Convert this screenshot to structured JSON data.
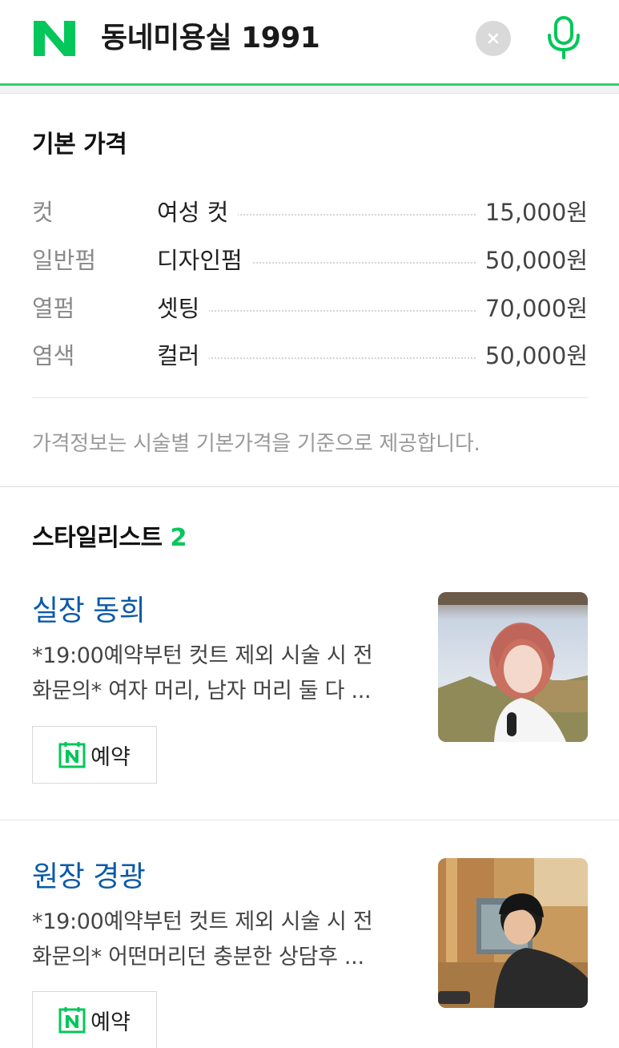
{
  "header": {
    "logo_letter": "N",
    "query": "동네미용실 1991",
    "clear_icon": "close-icon",
    "mic_icon": "microphone-icon",
    "accent_color": "#03c75a"
  },
  "prices": {
    "title": "기본 가격",
    "items": [
      {
        "category": "컷",
        "name": "여성 컷",
        "price": "15,000원"
      },
      {
        "category": "일반펌",
        "name": "디자인펌",
        "price": "50,000원"
      },
      {
        "category": "열펌",
        "name": "셋팅",
        "price": "70,000원"
      },
      {
        "category": "염색",
        "name": "컬러",
        "price": "50,000원"
      }
    ],
    "note": "가격정보는 시술별 기본가격을 기준으로 제공합니다."
  },
  "stylists": {
    "title": "스타일리스트",
    "count": "2",
    "items": [
      {
        "name": "실장 동희",
        "desc_line1": "*19:00예약부턴 컷트 제외 시술 시 전",
        "desc_line2": "화문의* 여자 머리, 남자 머리 둘 다 ...",
        "book_label": "예약"
      },
      {
        "name": "원장 경광",
        "desc_line1": "*19:00예약부턴 컷트 제외 시술 시 전",
        "desc_line2": "화문의* 어떤머리던 충분한 상담후 ...",
        "book_label": "예약"
      }
    ]
  }
}
